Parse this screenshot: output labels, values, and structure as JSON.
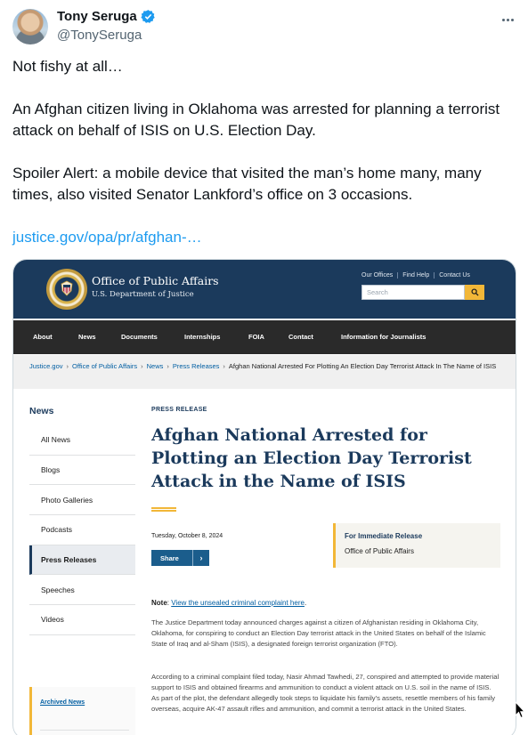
{
  "tweet": {
    "display_name": "Tony Seruga",
    "handle": "@TonySeruga",
    "paragraphs": [
      "Not fishy at all…",
      "An Afghan citizen living in Oklahoma was arrested for planning a terrorist attack on behalf of ISIS on U.S. Election Day.",
      "Spoiler Alert: a mobile device that visited the man’s home many, many times, also visited Senator Lankford’s office on 3 occasions."
    ],
    "link_text": "justice.gov/opa/pr/afghan-…",
    "verified_color": "#1d9bf0",
    "link_color": "#1d9bf0"
  },
  "doj": {
    "office_title": "Office of Public Affairs",
    "department": "U.S. Department of Justice",
    "util_links": [
      "Our Offices",
      "Find Help",
      "Contact Us"
    ],
    "search_placeholder": "Search",
    "nav": [
      "About",
      "News",
      "Documents",
      "Internships",
      "FOIA",
      "Contact",
      "Information for Journalists"
    ],
    "breadcrumbs": [
      "Justice.gov",
      "Office of Public Affairs",
      "News",
      "Press Releases"
    ],
    "breadcrumb_current": "Afghan National Arrested For Plotting An Election Day Terrorist Attack In The Name of ISIS",
    "sidebar_title": "News",
    "sidebar_items": [
      "All News",
      "Blogs",
      "Photo Galleries",
      "Podcasts",
      "Press Releases",
      "Speeches",
      "Videos"
    ],
    "sidebar_active": "Press Releases",
    "archived_label": "Archived News",
    "kicker": "PRESS RELEASE",
    "title": "Afghan National Arrested for Plotting an Election Day Terrorist Attack in the Name of ISIS",
    "date": "Tuesday, October 8, 2024",
    "share_label": "Share",
    "release_head": "For Immediate Release",
    "release_sub": "Office of Public Affairs",
    "note_label": "Note",
    "note_link": "View the unsealed criminal complaint here",
    "paragraph1": "The Justice Department today announced charges against a citizen of Afghanistan residing in Oklahoma City, Oklahoma, for conspiring to conduct an Election Day terrorist attack in the United States on behalf of the Islamic State of Iraq and al-Sham (ISIS), a designated foreign terrorist organization (FTO).",
    "paragraph2": "According to a criminal complaint filed today, Nasir Ahmad Tawhedi, 27, conspired and attempted to provide material support to ISIS and obtained firearms and ammunition to conduct a violent attack on U.S. soil in the name of ISIS. As part of the plot, the defendant allegedly took steps to liquidate his family’s assets, resettle members of his family overseas, acquire AK-47 assault rifles and ammunition, and commit a terrorist attack in the United States.",
    "colors": {
      "navy": "#1b3a5c",
      "gold": "#f2b738",
      "nav_bg": "#2a2a2a",
      "link": "#005ea2"
    }
  }
}
